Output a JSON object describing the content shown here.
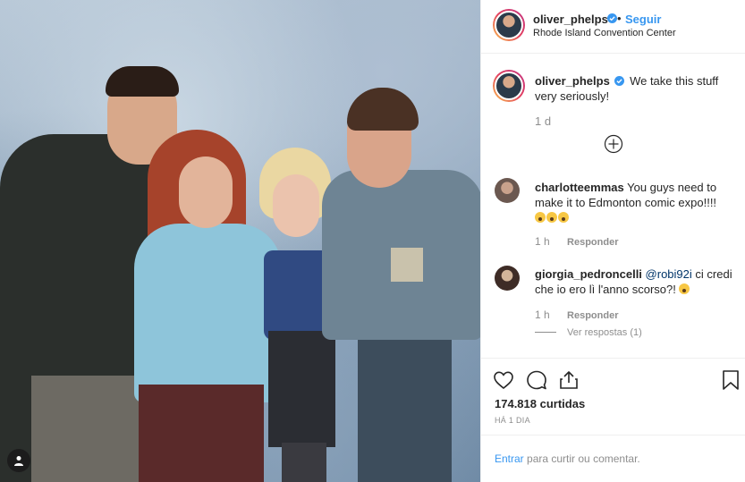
{
  "post": {
    "author": "oliver_phelps",
    "follow_label": "Seguir",
    "dot": "•",
    "location": "Rhode Island Convention Center",
    "caption_text": "We take this stuff very seriously!",
    "caption_time": "1 d"
  },
  "comments": [
    {
      "user": "charlotteemmas",
      "text": "You guys need to make it to Edmonton comic expo!!!!",
      "emoji_count": 3,
      "time": "1 h",
      "reply_label": "Responder"
    },
    {
      "user": "giorgia_pedroncelli",
      "mention": "@robi92i",
      "text": "ci credi che io ero lì l'anno scorso?!",
      "emoji_count": 1,
      "time": "1 h",
      "reply_label": "Responder",
      "view_replies": "Ver respostas (1)"
    }
  ],
  "footer": {
    "likes": "174.818 curtidas",
    "date": "HÁ 1 DIA",
    "login_link": "Entrar",
    "login_rest": "para curtir ou comentar."
  },
  "icons": {
    "verified": "verified-badge-icon",
    "load_more": "plus-circle-icon",
    "like": "heart-icon",
    "comment": "comment-bubble-icon",
    "share": "share-icon",
    "save": "bookmark-icon",
    "user_tag": "user-tag-icon"
  },
  "colors": {
    "link_blue": "#3897f0",
    "verified_blue": "#3897f0",
    "muted": "#8e8e8e",
    "text": "#262626"
  }
}
